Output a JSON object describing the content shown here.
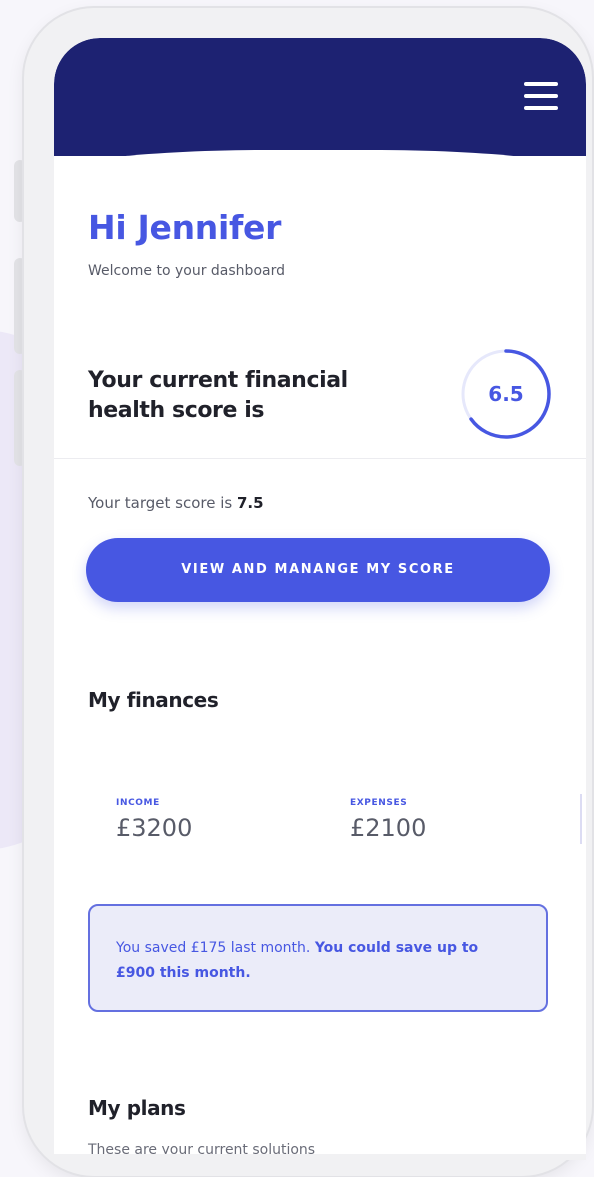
{
  "header": {
    "menu_icon": "hamburger-menu-icon",
    "background_color": "#1d2272"
  },
  "greeting": {
    "title": "Hi Jennifer",
    "subtitle": "Welcome to your dashboard"
  },
  "score": {
    "label": "Your current financial health score is",
    "value": "6.5",
    "target_prefix": "Your target score is ",
    "target_value": "7.5",
    "button_label": "VIEW AND MANANGE MY SCORE"
  },
  "finances": {
    "title": "My finances",
    "items": [
      {
        "label": "INCOME",
        "value": "£3200"
      },
      {
        "label": "EXPENSES",
        "value": "£2100"
      }
    ],
    "savings_message": "You saved £175 last month.",
    "savings_highlight": "You could save up to £900 this month."
  },
  "plans": {
    "title": "My plans",
    "description": "These are your current solutions"
  },
  "colors": {
    "accent": "#4757e2",
    "dark_text": "#20212a",
    "muted_text": "#585b68"
  }
}
